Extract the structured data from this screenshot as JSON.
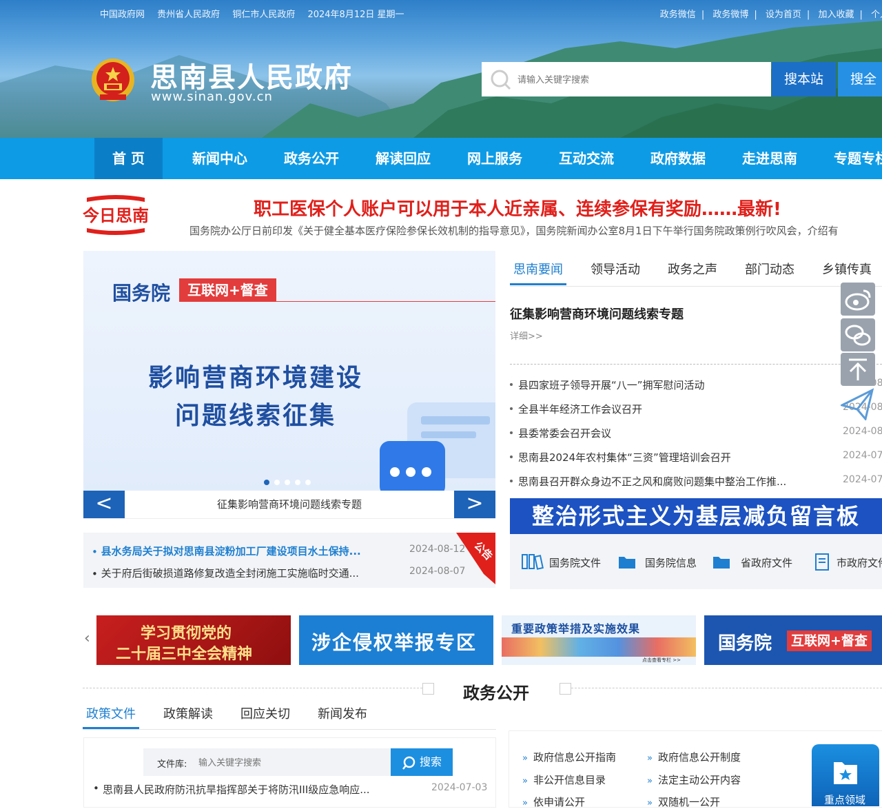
{
  "topbar": {
    "links": [
      "中国政府网",
      "贵州省人民政府",
      "铜仁市人民政府"
    ],
    "date": "2024年8月12日 星期一",
    "right_links": [
      "政务微信",
      "|",
      "政务微博",
      "|",
      "设为首页",
      "|",
      "加入收藏",
      "|",
      "个人"
    ]
  },
  "site": {
    "title": "思南县人民政府",
    "url": "www.sinan.gov.cn"
  },
  "search": {
    "placeholder": "请输入关键字搜索",
    "btn_site": "搜本站",
    "btn_all": "搜全"
  },
  "nav": [
    "首 页",
    "新闻中心",
    "政务公开",
    "解读回应",
    "网上服务",
    "互动交流",
    "政府数据",
    "走进思南",
    "专题专栏"
  ],
  "today": {
    "label": "今日思南",
    "headline": "职工医保个人账户可以用于本人近亲属、连续参保有奖励……最新!",
    "summary": "国务院办公厅日前印发《关于健全基本医疗保险参保长效机制的指导意见》，国务院新闻办公室8月1日下午举行国务院政策例行吹风会，介绍有"
  },
  "carousel": {
    "brand_left": "国务院",
    "brand_right": "互联网+督查",
    "line1": "影响营商环境建设",
    "line2": "问题线索征集",
    "caption": "征集影响营商环境问题线索专题",
    "prev": "<",
    "next": ">"
  },
  "notices": {
    "ribbon": "公告",
    "items": [
      {
        "title": "县水务局关于拟对思南县淀粉加工厂建设项目水土保持...",
        "date": "2024-08-12"
      },
      {
        "title": "关于府后街破损道路修复改造全封闭施工实施临时交通...",
        "date": "2024-08-07"
      }
    ]
  },
  "news": {
    "tabs": [
      "思南要闻",
      "领导活动",
      "政务之声",
      "部门动态",
      "乡镇传真"
    ],
    "lead": {
      "title": "征集影响营商环境问题线索专题",
      "more": "详细>>"
    },
    "items": [
      {
        "title": "县四家班子领导开展“八一”拥军慰问活动",
        "date": "2024-08"
      },
      {
        "title": "全县半年经济工作会议召开",
        "date": "2024-08"
      },
      {
        "title": "县委常委会召开会议",
        "date": "2024-08"
      },
      {
        "title": "思南县2024年农村集体“三资”管理培训会召开",
        "date": "2024-07"
      },
      {
        "title": "思南县召开群众身边不正之风和腐败问题集中整治工作推...",
        "date": "2024-07"
      }
    ]
  },
  "board": {
    "title": "整治形式主义为基层减负留言板"
  },
  "doc_links": [
    "国务院文件",
    "国务院信息",
    "省政府文件",
    "市政府文件"
  ],
  "promos": [
    {
      "l1": "学习贯彻党的",
      "l2": "二十届三中全会精神"
    },
    {
      "text": "涉企侵权举报专区"
    },
    {
      "text": "重要政策举措及实施效果",
      "sub": "点击查看专栏 >>"
    },
    {
      "left": "国务院",
      "right": "互联网+督查"
    }
  ],
  "section": {
    "title": "政务公开",
    "tabs": [
      "政策文件",
      "政策解读",
      "回应关切",
      "新闻发布"
    ],
    "lib_label": "文件库:",
    "lib_placeholder": "输入关键字搜索",
    "lib_btn": "搜索",
    "policy": {
      "title": "思南县人民政府防汛抗旱指挥部关于将防汛III级应急响应...",
      "date": "2024-07-03"
    },
    "gov_links": [
      "政府信息公开指南",
      "政府信息公开制度",
      "非公开信息目录",
      "法定主动公开内容",
      "依申请公开",
      "双随机一公开"
    ],
    "key_area": "重点领域"
  },
  "colors": {
    "nav": "#0e9be6",
    "headline": "#e0201b",
    "accent": "#1e7fd0"
  }
}
